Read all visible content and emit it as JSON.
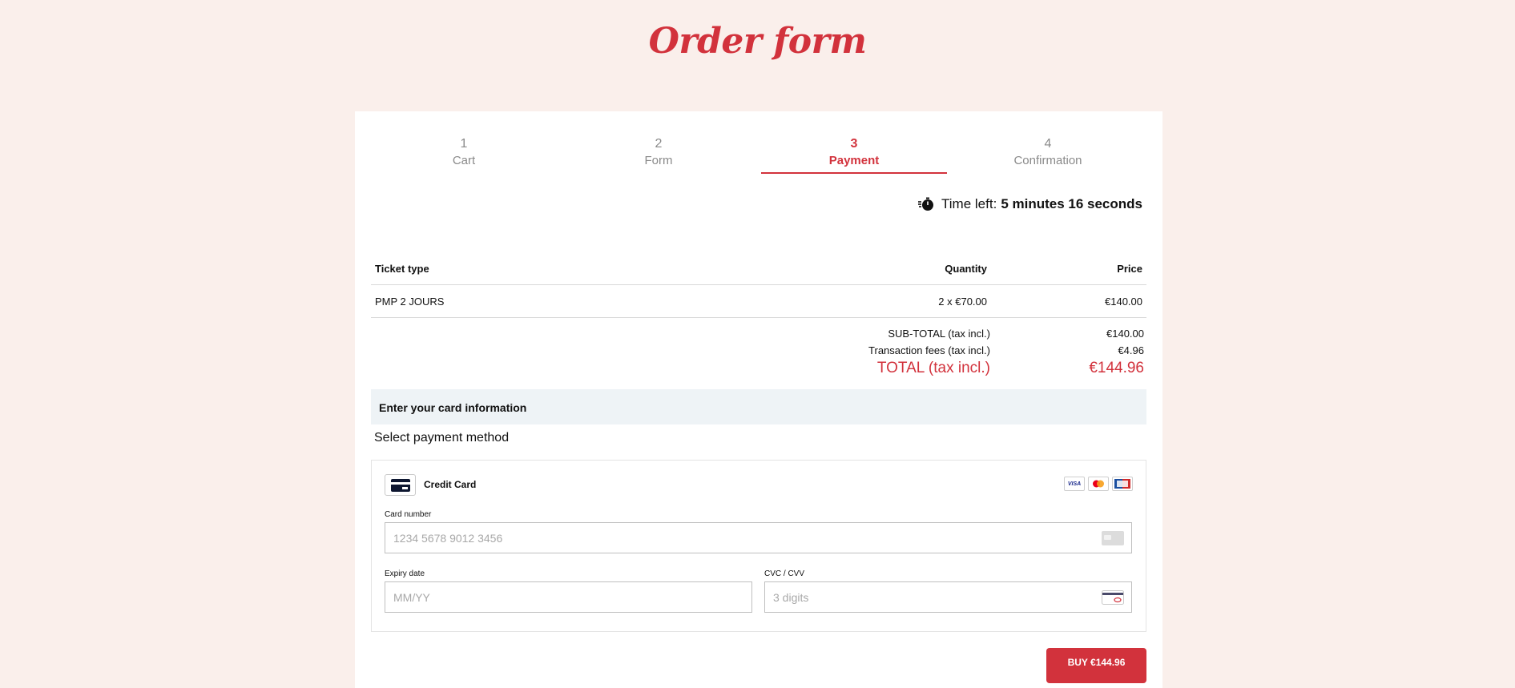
{
  "page": {
    "title": "Order form"
  },
  "steps": [
    {
      "num": "1",
      "label": "Cart"
    },
    {
      "num": "2",
      "label": "Form"
    },
    {
      "num": "3",
      "label": "Payment"
    },
    {
      "num": "4",
      "label": "Confirmation"
    }
  ],
  "active_step": 3,
  "timer": {
    "prefix": "Time left:",
    "value": "5 minutes 16 seconds"
  },
  "table": {
    "headers": [
      "Ticket type",
      "Quantity",
      "Price"
    ],
    "rows": [
      {
        "ticket": "PMP 2 JOURS",
        "quantity": "2 x €70.00",
        "price": "€140.00"
      }
    ]
  },
  "summary": {
    "subtotal_label": "SUB-TOTAL (tax incl.)",
    "subtotal_value": "€140.00",
    "fees_label": "Transaction fees (tax incl.)",
    "fees_value": "€4.96",
    "total_label": "TOTAL (tax incl.)",
    "total_value": "€144.96"
  },
  "card_section": {
    "heading": "Enter your card information",
    "select_label": "Select payment method",
    "method_label": "Credit Card",
    "brands": [
      "VISA",
      "mastercard",
      "CB"
    ],
    "card_number_label": "Card number",
    "card_number_placeholder": "1234 5678 9012 3456",
    "expiry_label": "Expiry date",
    "expiry_placeholder": "MM/YY",
    "cvc_label": "CVC / CVV",
    "cvc_placeholder": "3 digits"
  },
  "buy_button": "BUY €144.96",
  "colors": {
    "accent": "#d2323c",
    "background": "#faefeb",
    "section": "#eef3f6"
  }
}
